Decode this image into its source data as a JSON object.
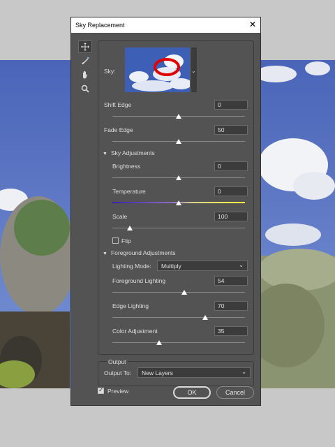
{
  "dialog": {
    "title": "Sky Replacement"
  },
  "tools": [
    "move-tool-icon",
    "sky-brush-icon",
    "hand-icon",
    "zoom-icon"
  ],
  "sky": {
    "label": "Sky:"
  },
  "shift_edge": {
    "label": "Shift Edge",
    "value": "0",
    "level": 0.5
  },
  "fade_edge": {
    "label": "Fade Edge",
    "value": "50",
    "level": 0.5
  },
  "sky_adjustments": {
    "title": "Sky Adjustments",
    "brightness": {
      "label": "Brightness",
      "value": "0",
      "level": 0.5
    },
    "temperature": {
      "label": "Temperature",
      "value": "0",
      "level": 0.5
    },
    "scale": {
      "label": "Scale",
      "value": "100",
      "level": 0.13
    },
    "flip": {
      "label": "Flip",
      "checked": false
    }
  },
  "foreground_adjustments": {
    "title": "Foreground Adjustments",
    "lighting_mode": {
      "label": "Lighting Mode:",
      "value": "Multiply"
    },
    "foreground_lighting": {
      "label": "Foreground Lighting",
      "value": "54",
      "level": 0.54
    },
    "edge_lighting": {
      "label": "Edge Lighting",
      "value": "70",
      "level": 0.7
    },
    "color_adjustment": {
      "label": "Color Adjustment",
      "value": "35",
      "level": 0.35
    }
  },
  "output": {
    "title": "Output",
    "output_to_label": "Output To:",
    "output_to_value": "New Layers"
  },
  "preview": {
    "label": "Preview",
    "checked": true
  },
  "buttons": {
    "ok": "OK",
    "cancel": "Cancel"
  },
  "colors": {
    "panel": "#535353",
    "field": "#3c3c3c",
    "highlight": "#e00000"
  }
}
